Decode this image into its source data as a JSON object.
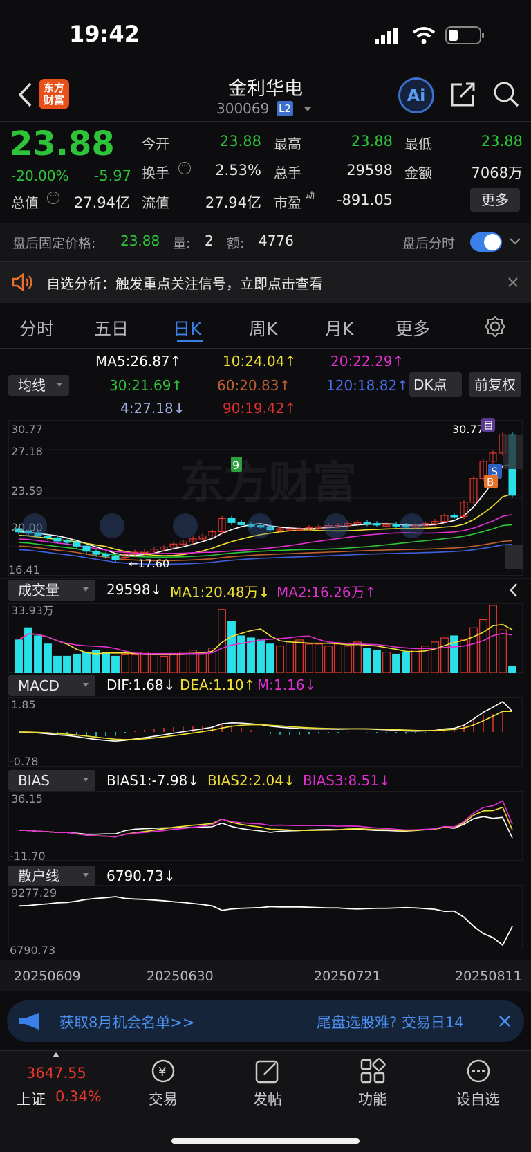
{
  "status": {
    "time": "19:42"
  },
  "header": {
    "logo": "东方\n财富",
    "stock_name": "金利华电",
    "stock_code": "300069",
    "level_badge": "L2"
  },
  "quote": {
    "price": "23.88",
    "change_pct": "-20.00%",
    "change_amt": "-5.97",
    "open_label": "今开",
    "open": "23.88",
    "high_label": "最高",
    "high": "23.88",
    "low_label": "最低",
    "low": "23.88",
    "turnover_label": "换手",
    "turnover": "2.53%",
    "volume_label": "总手",
    "volume": "29598",
    "amount_label": "金额",
    "amount": "7068万",
    "mktcap_label": "总值",
    "mktcap": "27.94亿",
    "float_label": "流值",
    "float": "27.94亿",
    "pe_label": "市盈",
    "pe_sup": "动",
    "pe": "-891.05",
    "more_button": "更多"
  },
  "after_hours": {
    "price_label": "盘后固定价格:",
    "price": "23.88",
    "qty_label": "量:",
    "qty": "2",
    "amt_label": "额:",
    "amt": "4776",
    "toggle_label": "盘后分时"
  },
  "notice": {
    "text": "自选分析：触发重点关注信号，立即点击查看"
  },
  "tabs": [
    "分时",
    "五日",
    "日K",
    "周K",
    "月K",
    "更多"
  ],
  "active_tab": "日K",
  "ma": {
    "selector": "均线",
    "ma5": "MA5:26.87↑",
    "ma10": "10:24.04↑",
    "ma20": "20:22.29↑",
    "ma30": "30:21.69↑",
    "ma60": "60:20.83↑",
    "ma120": "120:18.82↑",
    "ma4": "4:27.18↓",
    "ma90": "90:19.42↑",
    "dk_button": "DK点",
    "adjust_button": "前复权",
    "colors": {
      "ma5": "#ffffff",
      "ma10": "#f0e030",
      "ma20": "#e030d0",
      "ma30": "#2ec43a",
      "ma60": "#c06030",
      "ma120": "#4060e0",
      "ma4": "#a0b0e0",
      "ma90": "#e03030"
    }
  },
  "kline": {
    "axis_top": "30.77",
    "axis_2": "27.18",
    "axis_3": "23.59",
    "axis_4": "20.00",
    "axis_bottom": "16.41",
    "high_mark": "30.77",
    "low_mark": "←17.60",
    "watermark": "东方财富",
    "badge_s": "S",
    "badge_b": "B",
    "badge_mu": "目"
  },
  "chart_data": [
    {
      "type": "candlestick",
      "title": "日K",
      "ylim": [
        16.41,
        30.77
      ],
      "open": [
        20.6,
        20.3,
        20.2,
        19.9,
        19.7,
        19.4,
        19.3,
        18.9,
        18.4,
        18.1,
        17.9,
        17.8,
        18.1,
        18.3,
        18.4,
        18.6,
        18.8,
        19.1,
        19.3,
        19.6,
        19.9,
        20.3,
        21.6,
        21.2,
        21.0,
        20.9,
        20.8,
        20.5,
        20.6,
        20.6,
        20.6,
        20.7,
        20.8,
        20.9,
        20.9,
        21.1,
        21.2,
        21.1,
        21.0,
        21.0,
        20.9,
        20.8,
        20.9,
        21.1,
        21.3,
        21.9,
        21.8,
        23.2,
        25.5,
        27.2,
        28.0,
        29.8
      ],
      "close": [
        20.3,
        20.2,
        19.9,
        19.7,
        19.4,
        19.3,
        18.9,
        18.4,
        18.1,
        17.9,
        17.6,
        18.1,
        18.3,
        18.4,
        18.6,
        18.8,
        19.1,
        19.3,
        19.6,
        19.9,
        20.3,
        21.6,
        21.2,
        21.0,
        20.9,
        20.8,
        20.5,
        20.6,
        20.6,
        20.6,
        20.7,
        20.8,
        20.9,
        20.9,
        21.1,
        21.2,
        21.1,
        21.0,
        21.0,
        20.9,
        20.8,
        20.9,
        21.1,
        21.3,
        21.9,
        21.8,
        23.2,
        25.5,
        27.2,
        28.0,
        29.8,
        23.88
      ],
      "up_color": "#e8372f",
      "down_color": "#2ae0e8"
    },
    {
      "type": "bar",
      "title": "成交量",
      "legend": {
        "vol": "29598↓",
        "ma1": "MA1:20.48万↓",
        "ma2": "MA2:16.26万↑"
      },
      "ylim_label": "33.93万",
      "values": [
        16,
        22,
        18,
        14,
        8,
        8,
        9,
        10,
        11,
        10,
        8,
        9,
        9,
        10,
        9,
        8,
        9,
        10,
        11,
        10,
        12,
        31,
        25,
        18,
        17,
        16,
        14,
        13,
        15,
        16,
        14,
        14,
        13,
        14,
        13,
        15,
        12,
        11,
        10,
        9,
        10,
        11,
        13,
        15,
        17,
        18,
        16,
        22,
        26,
        33,
        21,
        3
      ]
    },
    {
      "type": "line",
      "title": "MACD",
      "legend": {
        "dif": "DIF:1.68↓",
        "dea": "DEA:1.10↑",
        "m": "M:1.16↓"
      },
      "axis_top": "1.85",
      "axis_bottom": "-0.78"
    },
    {
      "type": "line",
      "title": "BIAS",
      "legend": {
        "b1": "BIAS1:-7.98↓",
        "b2": "BIAS2:2.04↓",
        "b3": "BIAS3:8.51↓"
      },
      "axis_top": "36.15",
      "axis_bottom": "-11.70"
    },
    {
      "type": "line",
      "title": "散户线",
      "legend": {
        "v": "6790.73↓"
      },
      "axis_top": "9277.29",
      "axis_bottom": "6790.73",
      "dates": [
        "20250609",
        "20250630",
        "20250721",
        "20250811"
      ]
    }
  ],
  "promo": {
    "left": "获取8月机会名单>>",
    "right": "尾盘选股难? 交易日14"
  },
  "bottom": {
    "index_value": "3647.55",
    "index_name": "上证",
    "index_pct": "0.34%",
    "trade": "交易",
    "post": "发帖",
    "func": "功能",
    "watch": "设自选"
  }
}
